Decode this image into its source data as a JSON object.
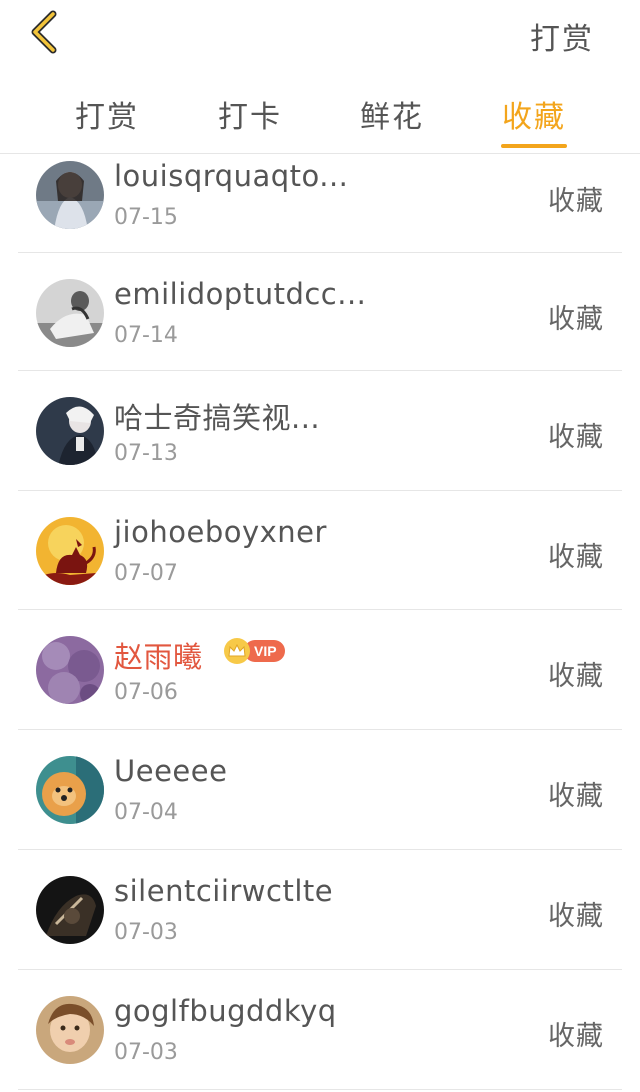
{
  "header": {
    "action_label": "打赏"
  },
  "tabs": [
    {
      "label": "打赏",
      "active": false
    },
    {
      "label": "打卡",
      "active": false
    },
    {
      "label": "鲜花",
      "active": false
    },
    {
      "label": "收藏",
      "active": true
    }
  ],
  "colors": {
    "accent": "#f3a51c",
    "vip_name": "#e2573f",
    "vip_badge": "#ee6a4c"
  },
  "list": [
    {
      "name": "louisqrquaqto...",
      "date": "07-15",
      "action": "收藏"
    },
    {
      "name": "emilidoptutdcc...",
      "date": "07-14",
      "action": "收藏"
    },
    {
      "name": "哈士奇搞笑视...",
      "date": "07-13",
      "action": "收藏"
    },
    {
      "name": "jiohoeboyxner",
      "date": "07-07",
      "action": "收藏"
    },
    {
      "name": "赵雨曦",
      "date": "07-06",
      "action": "收藏",
      "vip": true,
      "vip_label": "VIP"
    },
    {
      "name": "Ueeeee",
      "date": "07-04",
      "action": "收藏"
    },
    {
      "name": "silentciirwctlte",
      "date": "07-03",
      "action": "收藏"
    },
    {
      "name": "goglfbugddkyq",
      "date": "07-03",
      "action": "收藏"
    }
  ]
}
